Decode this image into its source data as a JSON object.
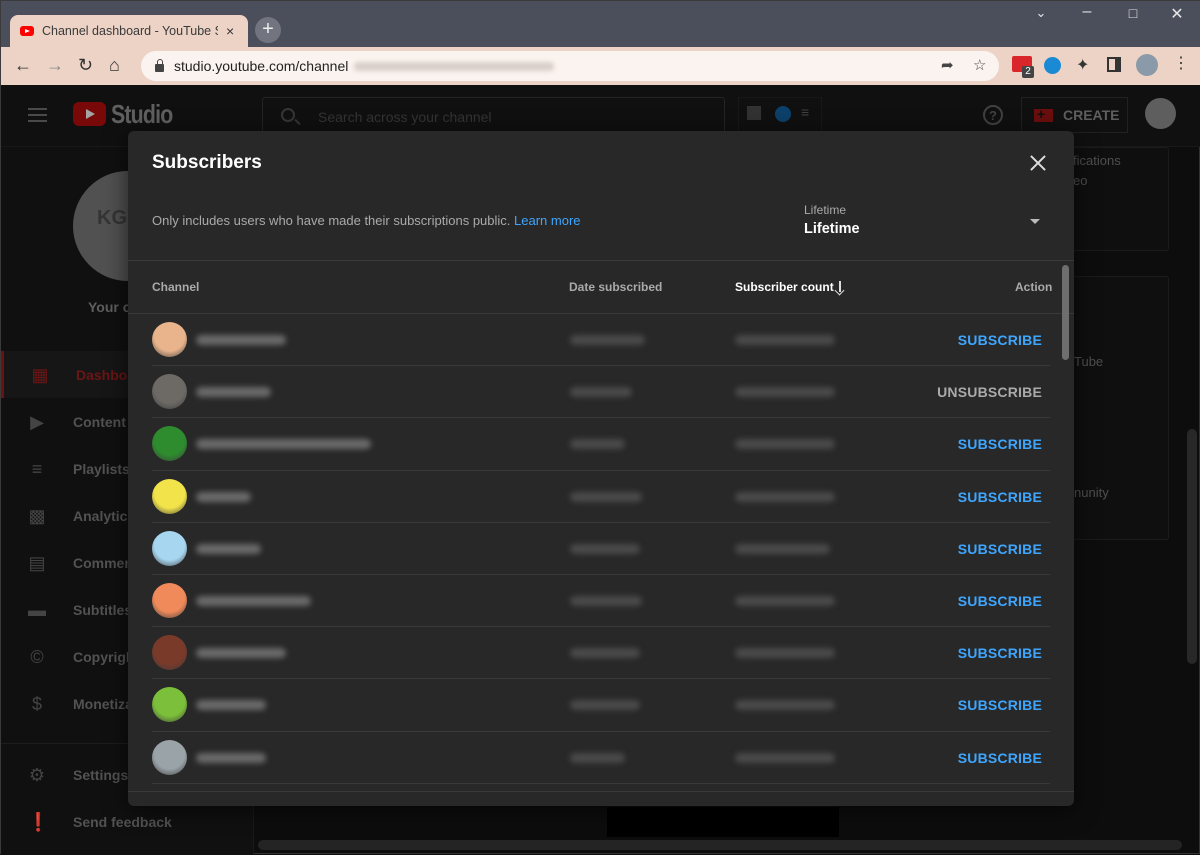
{
  "browser": {
    "tab_title": "Channel dashboard - YouTube Studio",
    "tab_close": "×",
    "new_tab": "+",
    "url_visible": "studio.youtube.com/channel",
    "extension_badge": "2"
  },
  "header": {
    "logo_text": "Studio",
    "search_placeholder": "Search across your channel",
    "help": "?",
    "create_label": "CREATE"
  },
  "sidebar": {
    "your_channel": "Your ch",
    "channel_initials": "KG",
    "items": [
      {
        "label": "Dashboard",
        "icon": "dashboard-icon",
        "active": true
      },
      {
        "label": "Content",
        "icon": "content-icon"
      },
      {
        "label": "Playlists",
        "icon": "playlists-icon"
      },
      {
        "label": "Analytics",
        "icon": "analytics-icon"
      },
      {
        "label": "Comments",
        "icon": "comments-icon"
      },
      {
        "label": "Subtitles",
        "icon": "subtitles-icon"
      },
      {
        "label": "Copyright",
        "icon": "copyright-icon"
      },
      {
        "label": "Monetization",
        "icon": "monetization-icon"
      }
    ],
    "bottom_items": [
      {
        "label": "Settings",
        "icon": "settings-icon"
      },
      {
        "label": "Send feedback",
        "icon": "feedback-icon"
      }
    ]
  },
  "background": {
    "notifications_fragment": "fications",
    "video_fragment": "eo",
    "youtube_fragment": "Tube",
    "community_fragment": "nunity"
  },
  "modal": {
    "title": "Subscribers",
    "note": "Only includes users who have made their subscriptions public.",
    "learn_more": "Learn more",
    "period_label": "Lifetime",
    "period_value": "Lifetime",
    "columns": {
      "channel": "Channel",
      "date": "Date subscribed",
      "count": "Subscriber count",
      "action": "Action"
    },
    "sorted_by": "Subscriber count",
    "sort_direction": "descending",
    "rows": [
      {
        "action": "SUBSCRIBE",
        "subscribed": false,
        "avatar_color": "#e9b48c"
      },
      {
        "action": "UNSUBSCRIBE",
        "subscribed": true,
        "avatar_color": "#6d6a66"
      },
      {
        "action": "SUBSCRIBE",
        "subscribed": false,
        "avatar_color": "#2e8b2e"
      },
      {
        "action": "SUBSCRIBE",
        "subscribed": false,
        "avatar_color": "#f2e34a"
      },
      {
        "action": "SUBSCRIBE",
        "subscribed": false,
        "avatar_color": "#a7d6f0"
      },
      {
        "action": "SUBSCRIBE",
        "subscribed": false,
        "avatar_color": "#f08a5a"
      },
      {
        "action": "SUBSCRIBE",
        "subscribed": false,
        "avatar_color": "#7a3a2a"
      },
      {
        "action": "SUBSCRIBE",
        "subscribed": false,
        "avatar_color": "#7cbf3a"
      },
      {
        "action": "SUBSCRIBE",
        "subscribed": false,
        "avatar_color": "#9aa3a8"
      }
    ]
  },
  "colors": {
    "accent_blue": "#3ea6ff",
    "yt_red": "#ff0000",
    "modal_bg": "#282828"
  }
}
